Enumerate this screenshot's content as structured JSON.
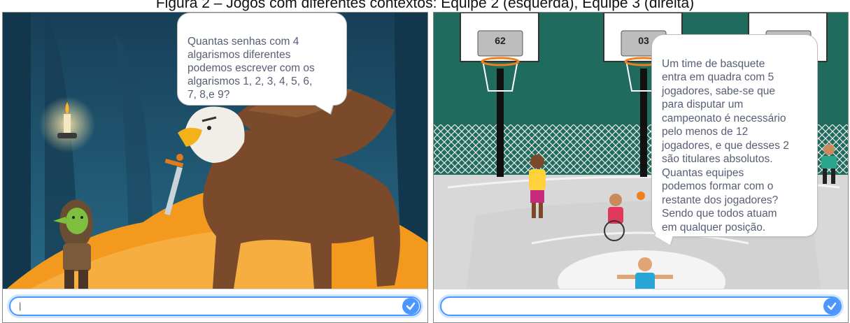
{
  "caption": "Figura 2 – Jogos com diferentes contextos: Equipe 2 (esquerda), Equipe 3 (direita)",
  "left_game": {
    "question": "Quantas senhas com 4\nalgarismos diferentes\npodemos escrever com os\nalgarismos 1, 2, 3, 4, 5, 6,\n7, 8,e 9?",
    "answer_value": "|",
    "submit_icon": "check-icon"
  },
  "right_game": {
    "scoreboard_left": "62",
    "scoreboard_middle": "03",
    "question": "Um time de basquete\nentra em quadra com 5\njogadores, sabe-se que\npara disputar um\ncampeonato é necessário\npelo menos de 12\njogadores, e que desses 2\nsão titulares absolutos.\nQuantas equipes\npodemos formar com o\nrestante dos jogadores?\nSendo que todos atuam\nem qualquer posição.",
    "answer_value": "",
    "submit_icon": "check-icon"
  },
  "colors": {
    "dungeon_bg": "#1f5470",
    "gold": "#f39a1e",
    "griffin_body": "#7a4a2a",
    "court_wall": "#1f6b5e",
    "court_floor": "#d9d9d9",
    "accent_blue": "#4c97ff"
  }
}
